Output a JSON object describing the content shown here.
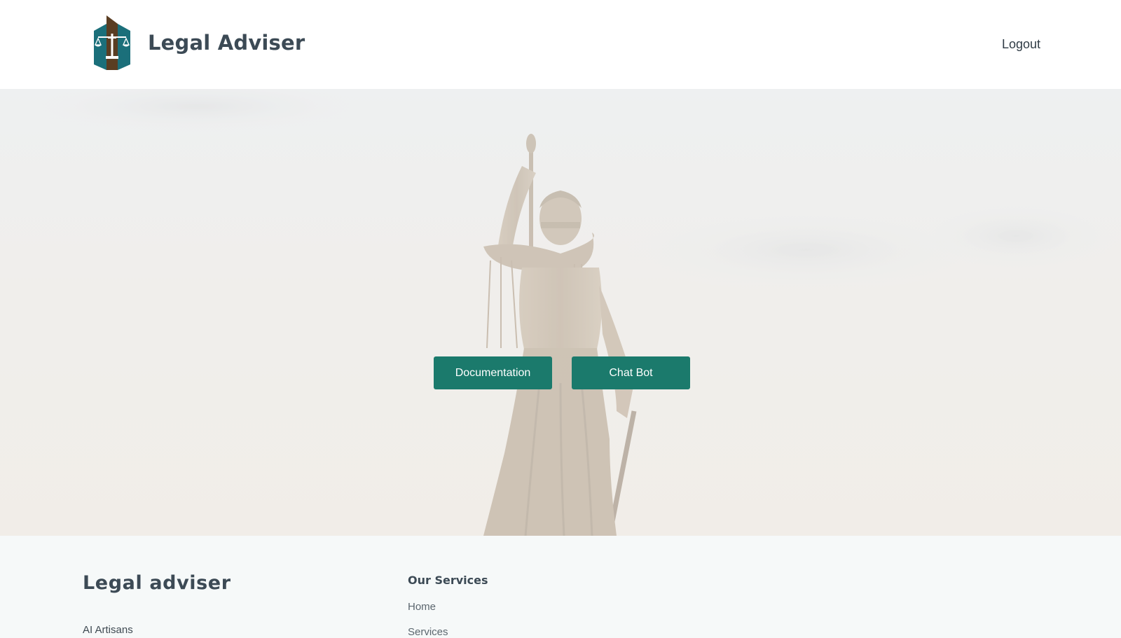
{
  "header": {
    "brand": "Legal Adviser",
    "logout_label": "Logout",
    "logo_icon": "scales-of-justice-logo-icon"
  },
  "hero": {
    "background_image": "lady-justice-statue",
    "buttons": {
      "documentation": "Documentation",
      "chat_bot": "Chat Bot"
    }
  },
  "footer": {
    "title": "Legal adviser",
    "subtitle": "AI Artisans",
    "services_heading": "Our Services",
    "services": [
      "Home",
      "Services"
    ]
  },
  "colors": {
    "accent": "#1b7a6c",
    "logo_teal": "#1b6f7a",
    "logo_brown": "#5a3d22",
    "text_dark": "#3c4a55"
  }
}
